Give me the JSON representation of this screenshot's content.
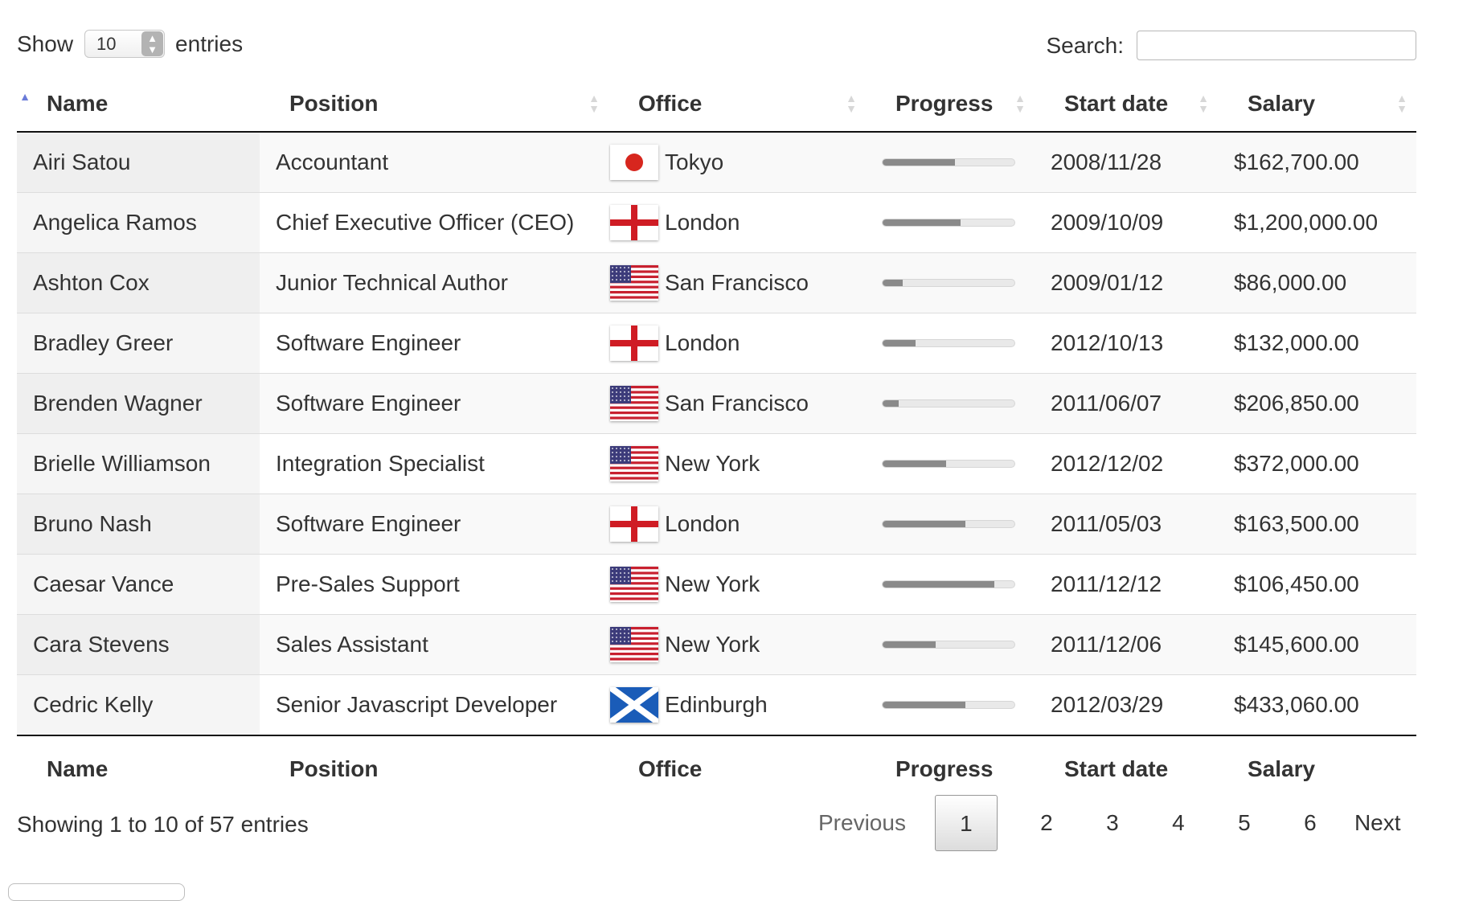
{
  "length_control": {
    "prefix": "Show",
    "value": "10",
    "suffix": "entries",
    "spinner_up": "▲",
    "spinner_down": "▼"
  },
  "search": {
    "label": "Search:",
    "value": "",
    "placeholder": ""
  },
  "sort_icons": {
    "asc": "▲",
    "both": "▲\n▼"
  },
  "table": {
    "sorted_column": "Name",
    "sort_direction": "ascending",
    "columns": [
      "Name",
      "Position",
      "Office",
      "Progress",
      "Start date",
      "Salary"
    ],
    "footer_columns": [
      "Name",
      "Position",
      "Office",
      "Progress",
      "Start date",
      "Salary"
    ],
    "rows": [
      {
        "name": "Airi Satou",
        "position": "Accountant",
        "office": "Tokyo",
        "flag": "japan-flag-icon",
        "progress_pct": 55,
        "start_date": "2008/11/28",
        "salary": "$162,700.00"
      },
      {
        "name": "Angelica Ramos",
        "position": "Chief Executive Officer (CEO)",
        "office": "London",
        "flag": "england-flag-icon",
        "progress_pct": 59,
        "start_date": "2009/10/09",
        "salary": "$1,200,000.00"
      },
      {
        "name": "Ashton Cox",
        "position": "Junior Technical Author",
        "office": "San Francisco",
        "flag": "usa-flag-icon",
        "progress_pct": 15,
        "start_date": "2009/01/12",
        "salary": "$86,000.00"
      },
      {
        "name": "Bradley Greer",
        "position": "Software Engineer",
        "office": "London",
        "flag": "england-flag-icon",
        "progress_pct": 25,
        "start_date": "2012/10/13",
        "salary": "$132,000.00"
      },
      {
        "name": "Brenden Wagner",
        "position": "Software Engineer",
        "office": "San Francisco",
        "flag": "usa-flag-icon",
        "progress_pct": 12,
        "start_date": "2011/06/07",
        "salary": "$206,850.00"
      },
      {
        "name": "Brielle Williamson",
        "position": "Integration Specialist",
        "office": "New York",
        "flag": "usa-flag-icon",
        "progress_pct": 48,
        "start_date": "2012/12/02",
        "salary": "$372,000.00"
      },
      {
        "name": "Bruno Nash",
        "position": "Software Engineer",
        "office": "London",
        "flag": "england-flag-icon",
        "progress_pct": 63,
        "start_date": "2011/05/03",
        "salary": "$163,500.00"
      },
      {
        "name": "Caesar Vance",
        "position": "Pre-Sales Support",
        "office": "New York",
        "flag": "usa-flag-icon",
        "progress_pct": 85,
        "start_date": "2011/12/12",
        "salary": "$106,450.00"
      },
      {
        "name": "Cara Stevens",
        "position": "Sales Assistant",
        "office": "New York",
        "flag": "usa-flag-icon",
        "progress_pct": 40,
        "start_date": "2011/12/06",
        "salary": "$145,600.00"
      },
      {
        "name": "Cedric Kelly",
        "position": "Senior Javascript Developer",
        "office": "Edinburgh",
        "flag": "scotland-flag-icon",
        "progress_pct": 63,
        "start_date": "2012/03/29",
        "salary": "$433,060.00"
      }
    ]
  },
  "info": "Showing 1 to 10 of 57 entries",
  "pagination": {
    "previous": "Previous",
    "pages": [
      "1",
      "2",
      "3",
      "4",
      "5",
      "6"
    ],
    "current": "1",
    "next": "Next"
  },
  "colors": {
    "sort_active": "#6a7bd8",
    "sort_inactive": "#d7d7d7",
    "progress_fill": "#8a8a8a",
    "progress_track": "#e9e9e9",
    "row_odd": "#f9f9f9",
    "sorted_column_shade": "#efefef"
  }
}
